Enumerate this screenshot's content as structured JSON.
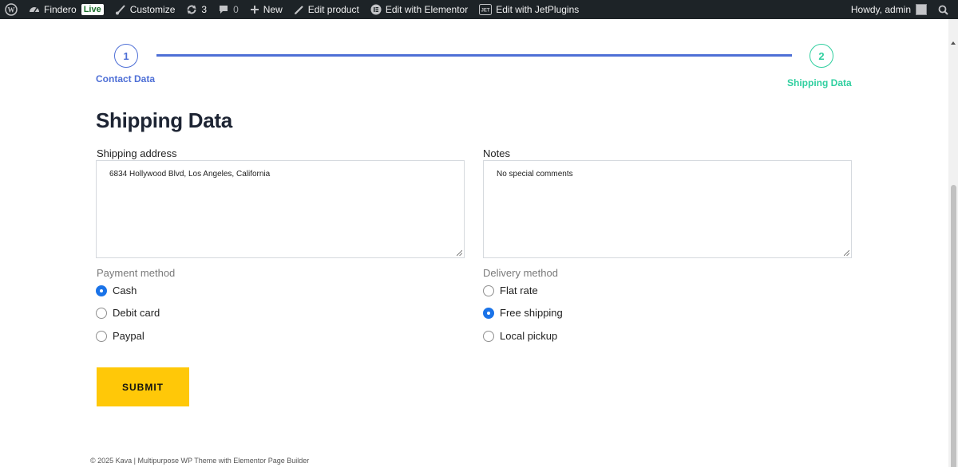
{
  "adminbar": {
    "site_name": "Findero",
    "live_badge": "Live",
    "customize": "Customize",
    "updates_count": "3",
    "comments_count": "0",
    "new": "New",
    "edit_product": "Edit product",
    "edit_elementor": "Edit with Elementor",
    "edit_jetplugins": "Edit with JetPlugins",
    "greeting": "Howdy, admin"
  },
  "steps": [
    {
      "number": "1",
      "label": "Contact Data",
      "color": "#4e6fd6"
    },
    {
      "number": "2",
      "label": "Shipping Data",
      "color": "#2fcf9f"
    }
  ],
  "form": {
    "title": "Shipping Data",
    "shipping_address": {
      "label": "Shipping address",
      "value": "6834 Hollywood Blvd, Los Angeles, California"
    },
    "notes": {
      "label": "Notes",
      "value": "No special comments"
    },
    "payment": {
      "label": "Payment method",
      "options": [
        "Cash",
        "Debit card",
        "Paypal"
      ],
      "selected": "Cash"
    },
    "delivery": {
      "label": "Delivery method",
      "options": [
        "Flat rate",
        "Free shipping",
        "Local pickup"
      ],
      "selected": "Free shipping"
    },
    "submit_label": "SUBMIT"
  },
  "footer": {
    "text": "© 2025 Kava | Multipurpose WP Theme with Elementor Page Builder"
  },
  "colors": {
    "accent_blue": "#4e6fd6",
    "accent_green": "#2fcf9f",
    "submit_yellow": "#ffc808"
  }
}
